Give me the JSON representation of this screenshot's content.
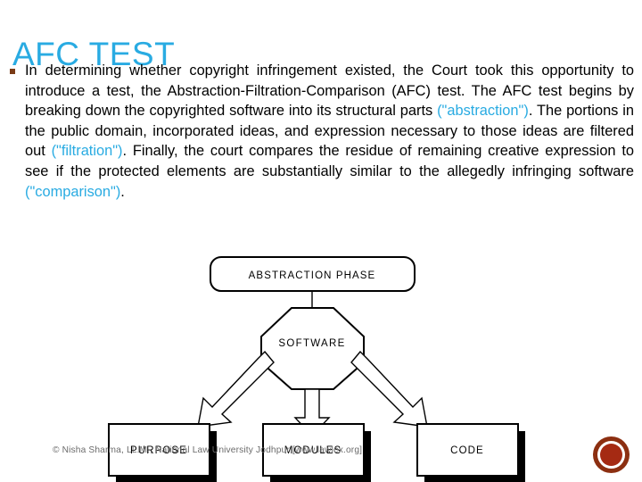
{
  "slide": {
    "title": "AFC TEST",
    "title_color": "#29abe2",
    "background_color": "#ffffff"
  },
  "body": {
    "bullet_glyph": "square-bullet",
    "bullet_color": "#7a3b16",
    "segments": [
      {
        "text": "In determining whether copyright infringement existed, the Court took this opportunity to introduce a test, the Abstraction-Filtration-Comparison (AFC) test. The AFC test begins by breaking down the copyrighted software into its structural parts ",
        "highlight": false
      },
      {
        "text": "(\"abstraction\")",
        "highlight": true
      },
      {
        "text": ". The portions in the public domain, incorporated ideas, and expression necessary to those ideas are filtered out ",
        "highlight": false
      },
      {
        "text": "(\"filtration\")",
        "highlight": true
      },
      {
        "text": ". Finally, the court compares the residue of remaining creative expression to see if the protected elements are substantially similar to the allegedly infringing software ",
        "highlight": false
      },
      {
        "text": "(\"comparison\")",
        "highlight": true
      },
      {
        "text": ".",
        "highlight": false
      }
    ]
  },
  "diagram": {
    "phase_label": "ABSTRACTION PHASE",
    "software_label": "SOFTWARE",
    "outputs": [
      {
        "label": "PURPOSE"
      },
      {
        "label": "MODULES"
      },
      {
        "label": "CODE"
      }
    ],
    "stroke_color": "#000000",
    "fill_color": "#ffffff",
    "shadow_color": "#000000"
  },
  "footer": {
    "note": "© Nisha Sharma, LL.M., National Law University Jodhpur [www.lawlex.org]"
  },
  "record_indicator": {
    "ring_color": "#8c2f11",
    "core_color": "#a52a13"
  }
}
